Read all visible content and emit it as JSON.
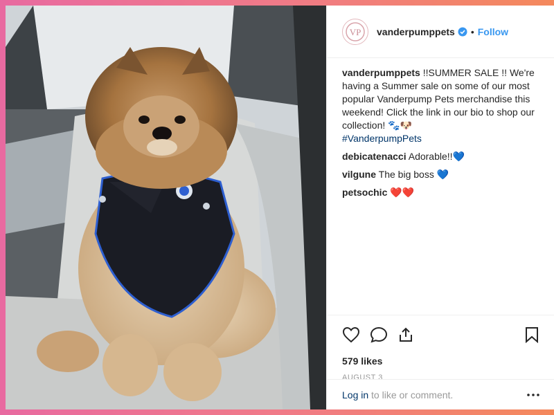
{
  "post": {
    "username": "vanderpumppets",
    "follow_label": "Follow",
    "separator": "•",
    "caption": {
      "username": "vanderpumppets",
      "text": "!!SUMMER SALE !! We're having a Summer sale on some of our most popular Vanderpump Pets merchandise this weekend! Click the link in our bio to shop our collection! 🐾🐶",
      "hashtag": "#VanderpumpPets"
    },
    "comments": [
      {
        "username": "debicatenacci",
        "text": "Adorable!!💙"
      },
      {
        "username": "vilgune",
        "text": "The big boss 💙"
      },
      {
        "username": "petsochic",
        "text": "❤️❤️"
      }
    ],
    "likes": "579 likes",
    "date": "AUGUST 3",
    "login_link": "Log in",
    "login_text": " to like or comment.",
    "avatar_text": "VP"
  },
  "icons": {
    "like": "heart-icon",
    "comment": "comment-icon",
    "share": "share-icon",
    "save": "bookmark-icon",
    "verified": "verified-badge-icon",
    "more": "more-options-icon"
  },
  "colors": {
    "link": "#3897f0",
    "hashtag": "#003569",
    "muted": "#999999",
    "text": "#262626"
  }
}
